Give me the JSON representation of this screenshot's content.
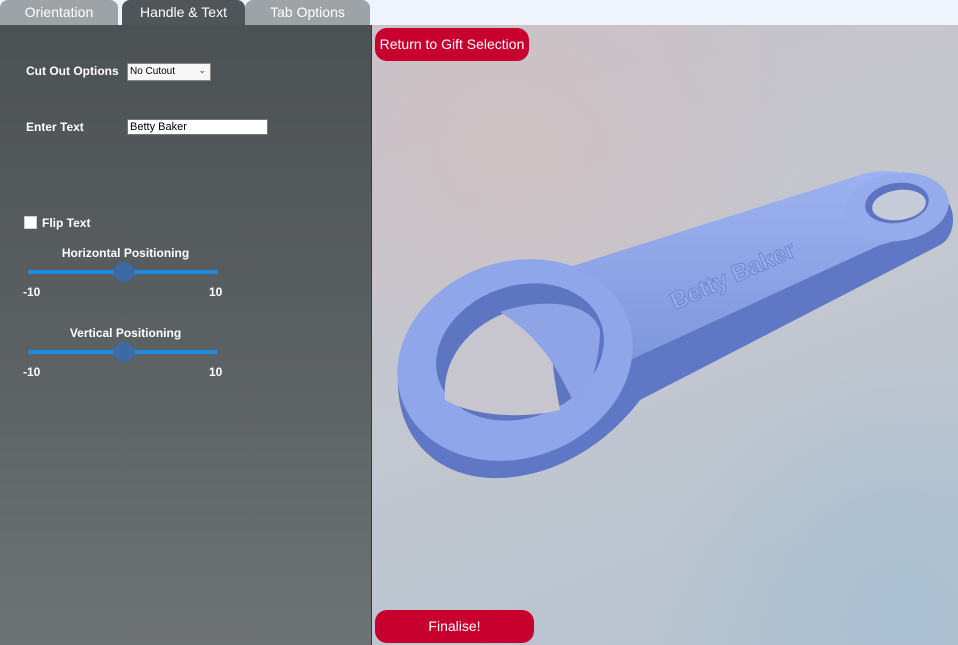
{
  "tabs": [
    {
      "label": "Orientation",
      "active": false
    },
    {
      "label": "Handle & Text",
      "active": true
    },
    {
      "label": "Tab Options",
      "active": false
    }
  ],
  "panel": {
    "cutout_label": "Cut Out Options",
    "cutout_value": "No Cutout",
    "text_label": "Enter Text",
    "text_value": "Betty Baker",
    "flip_label": "Flip Text",
    "flip_checked": false,
    "horizontal": {
      "label": "Horizontal Positioning",
      "min": "-10",
      "max": "10",
      "value": 0
    },
    "vertical": {
      "label": "Vertical Positioning",
      "min": "-10",
      "max": "10",
      "value": 0
    }
  },
  "viewport": {
    "return_label": "Return to Gift Selection",
    "finalise_label": "Finalise!",
    "engraved_text": "Betty Baker",
    "model_color": "#8fa6ea"
  },
  "colors": {
    "accent": "#c8002e",
    "slider": "#1e8ae0",
    "thumb": "#3d6aa2"
  }
}
